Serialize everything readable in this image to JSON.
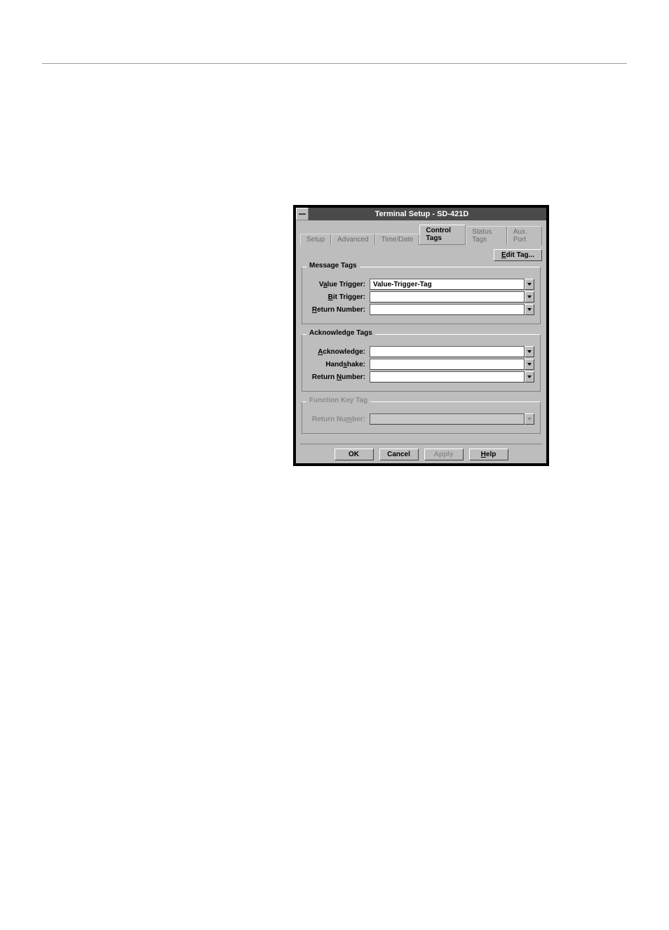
{
  "dialog": {
    "title": "Terminal Setup - SD-421D",
    "tabs": [
      {
        "label": "Setup",
        "active": false
      },
      {
        "label": "Advanced",
        "active": false
      },
      {
        "label": "Time/Date",
        "active": false
      },
      {
        "label": "Control Tags",
        "active": true
      },
      {
        "label": "Status Tags",
        "active": false
      },
      {
        "label": "Aux. Port",
        "active": false
      }
    ],
    "edit_tag_label": "Edit Tag...",
    "groups": {
      "message": {
        "legend": "Message Tags",
        "value_trigger": {
          "label_pre": "V",
          "label_ul": "a",
          "label_post": "lue Trigger:",
          "value": "Value-Trigger-Tag"
        },
        "bit_trigger": {
          "label_ul": "B",
          "label_post": "it Trigger:",
          "value": ""
        },
        "return_number": {
          "label_ul": "R",
          "label_post": "eturn Number:",
          "value": ""
        }
      },
      "ack": {
        "legend": "Acknowledge Tags",
        "acknowledge": {
          "label_ul": "A",
          "label_post": "cknowledge:",
          "value": ""
        },
        "handshake": {
          "label_pre": "Hand",
          "label_ul": "s",
          "label_post": "hake:",
          "value": ""
        },
        "return_number": {
          "label_pre": "Return ",
          "label_ul": "N",
          "label_post": "umber:",
          "value": ""
        }
      },
      "fkey": {
        "legend": "Function Key Tag",
        "return_number": {
          "label_pre": "Return Nu",
          "label_ul": "m",
          "label_post": "ber:",
          "value": ""
        }
      }
    },
    "buttons": {
      "ok": "OK",
      "cancel": "Cancel",
      "apply": "Apply",
      "help_ul": "H",
      "help_post": "elp"
    }
  }
}
